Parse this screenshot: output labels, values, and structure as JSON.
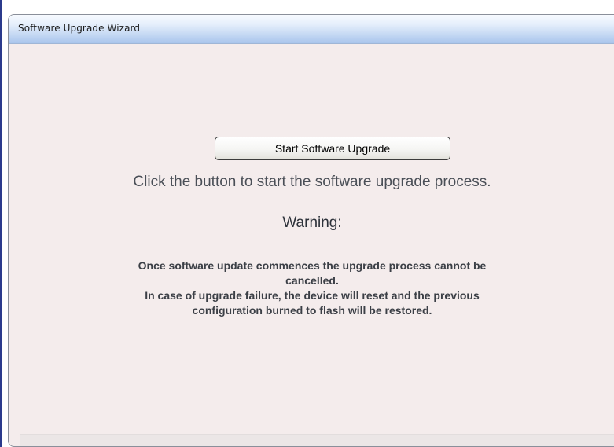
{
  "wizard": {
    "title": "Software Upgrade Wizard"
  },
  "main": {
    "start_button_label": "Start Software Upgrade",
    "instruction": "Click the button to start the software upgrade process.",
    "warning_heading": "Warning:",
    "warning_lines": [
      "Once software update commences the upgrade process cannot be",
      "cancelled.",
      "In case of upgrade failure, the device will reset and the previous",
      "configuration burned to flash will be restored."
    ]
  },
  "colors": {
    "panel_background": "#f4ecec",
    "titlebar_accent": "#a9c5ec",
    "frame_border": "#2b3a8c"
  }
}
